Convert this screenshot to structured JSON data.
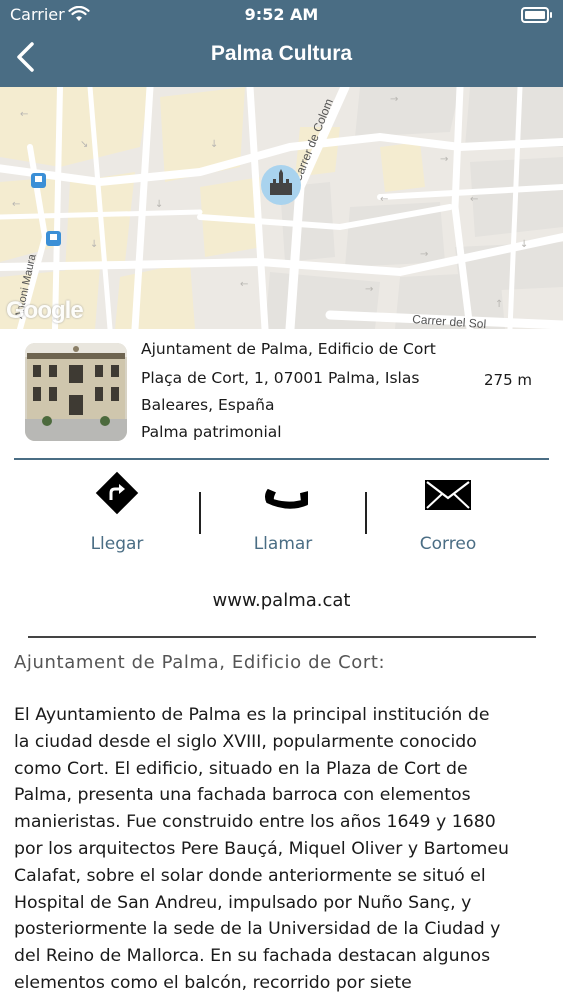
{
  "status_bar": {
    "carrier": "Carrier",
    "time": "9:52 AM"
  },
  "nav": {
    "title": "Palma Cultura",
    "back_icon": "chevron-left-icon"
  },
  "map": {
    "watermark": "Google",
    "street_labels": [
      "Carrer de Colom",
      "Carrer del Sol",
      "Antoni Maura"
    ],
    "marker_icon": "castle-marker-icon"
  },
  "place": {
    "name": "Ajuntament de Palma, Edificio de Cort",
    "address_line1": "Plaça de Cort, 1, 07001 Palma, Islas",
    "address_line2": "Baleares, España",
    "category": "Palma patrimonial",
    "distance": "275 m"
  },
  "actions": [
    {
      "label": "Llegar",
      "icon": "directions-icon"
    },
    {
      "label": "Llamar",
      "icon": "phone-icon"
    },
    {
      "label": "Correo",
      "icon": "envelope-icon"
    }
  ],
  "website": "www.palma.cat",
  "description": {
    "title": "Ajuntament de Palma, Edificio de Cort:",
    "body": "El Ayuntamiento de Palma es la principal institución de\nla ciudad desde el siglo XVIII, popularmente conocido\ncomo Cort. El edificio, situado en la Plaza de Cort de\nPalma, presenta una fachada barroca con elementos\nmanieristas. Fue construido entre los años 1649 y 1680\npor los arquitectos Pere Bauçá, Miquel Oliver y Bartomeu\nCalafat, sobre el solar donde anteriormente se situó el\nHospital de San Andreu, impulsado por Nuño Sanç, y\nposteriormente la sede de la Universidad de la Ciudad y\ndel Reino de Mallorca. En su fachada destacan algunos\nelementos como el balcón, recorrido por siete"
  },
  "colors": {
    "nav_bar": "#4a6d84",
    "accent": "#4a6d84",
    "map_marker": "#a9d3ee"
  }
}
